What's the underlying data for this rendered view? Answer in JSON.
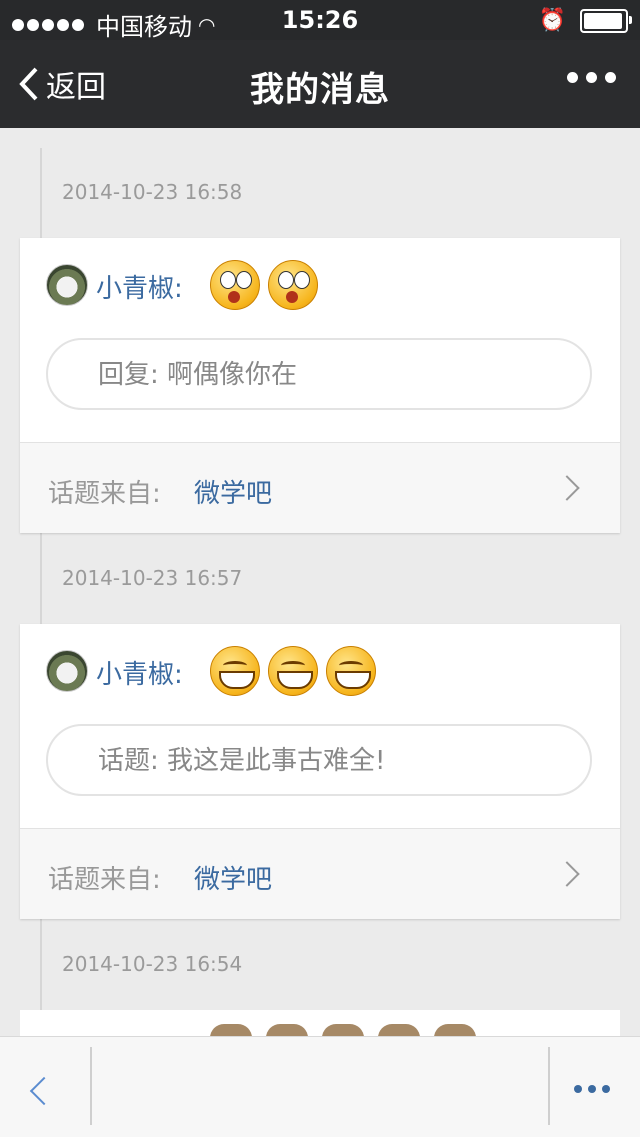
{
  "status": {
    "carrier": "中国移动",
    "time": "15:26",
    "battery_level": 0.95
  },
  "nav": {
    "back_label": "返回",
    "title": "我的消息"
  },
  "messages": [
    {
      "time": "2014-10-23 16:58",
      "user": "小青椒:",
      "emojis": [
        "surprised",
        "surprised"
      ],
      "body": "回复: 啊偶像你在",
      "source_label": "话题来自:",
      "source_name": "微学吧"
    },
    {
      "time": "2014-10-23 16:57",
      "user": "小青椒:",
      "emojis": [
        "grin",
        "grin",
        "grin"
      ],
      "body": "话题: 我这是此事古难全!",
      "source_label": "话题来自:",
      "source_name": "微学吧"
    },
    {
      "time": "2014-10-23 16:54"
    }
  ]
}
